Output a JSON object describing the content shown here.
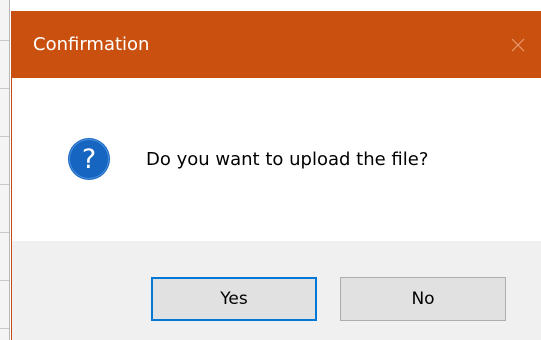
{
  "dialog": {
    "title": "Confirmation",
    "message": "Do you want to upload the file?",
    "icon": "question-icon",
    "buttons": {
      "yes_label": "Yes",
      "no_label": "No"
    },
    "default_button": "yes"
  },
  "colors": {
    "titlebar": "#c9500f",
    "footer": "#f0f0f0",
    "icon_blue": "#1665c0",
    "focus_border": "#0078d7"
  }
}
